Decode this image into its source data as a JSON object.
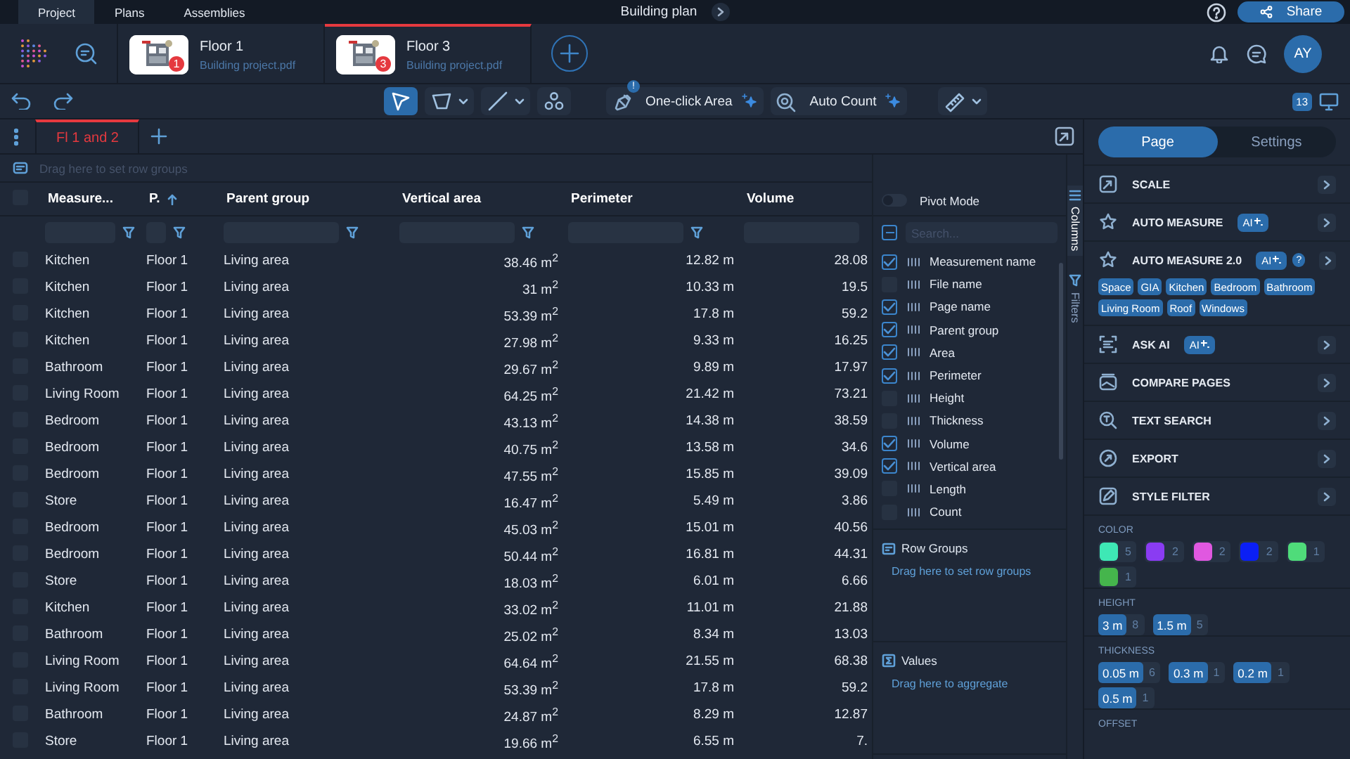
{
  "top_tabs": [
    {
      "label": "Project",
      "selected": true
    },
    {
      "label": "Plans",
      "selected": false
    },
    {
      "label": "Assemblies",
      "selected": false
    }
  ],
  "title": "Building plan",
  "share_button": "Share",
  "documents": [
    {
      "name": "Floor 1",
      "file": "Building project.pdf",
      "badge": "1",
      "selected": false
    },
    {
      "name": "Floor 3",
      "file": "Building project.pdf",
      "badge": "3",
      "selected": true
    }
  ],
  "avatar": "AY",
  "toolbar": {
    "tools": [
      {
        "kind": "select",
        "selected": true,
        "dropdown": false
      },
      {
        "kind": "polygon",
        "selected": false,
        "dropdown": true
      },
      {
        "kind": "line",
        "selected": false,
        "dropdown": true
      },
      {
        "kind": "count",
        "selected": false,
        "dropdown": false
      }
    ],
    "ai_buttons": [
      {
        "kind": "area",
        "label": "One-click Area",
        "badge": "!"
      },
      {
        "kind": "count",
        "label": "Auto Count"
      }
    ],
    "measure_tool": {
      "dropdown": true
    },
    "page_count": "13"
  },
  "sheet_tabs": [
    {
      "label": "Fl 1 and 2",
      "selected": true
    }
  ],
  "grid": {
    "group_hint": "Drag here to set row groups",
    "columns": [
      {
        "label": "Measure...",
        "kind": "text",
        "sorted": false,
        "filter_icon": true
      },
      {
        "label": "P.",
        "kind": "text",
        "sorted": true,
        "filter_icon": true
      },
      {
        "label": "Parent group",
        "kind": "text",
        "sorted": false,
        "filter_icon": true
      },
      {
        "label": "Vertical area",
        "kind": "number",
        "sorted": false,
        "filter_icon": true
      },
      {
        "label": "Perimeter",
        "kind": "number",
        "sorted": false,
        "filter_icon": true
      },
      {
        "label": "Volume",
        "kind": "number",
        "sorted": false,
        "filter_icon": false
      }
    ],
    "all_checked": false,
    "rows": [
      {
        "checked": false,
        "cells": [
          "Kitchen",
          "Floor 1",
          "Living area",
          "38.46 m$^{2}$",
          "12.82 m",
          "28.08"
        ]
      },
      {
        "checked": false,
        "cells": [
          "Kitchen",
          "Floor 1",
          "Living area",
          "31 m$^{2}$",
          "10.33 m",
          "19.5"
        ]
      },
      {
        "checked": false,
        "cells": [
          "Kitchen",
          "Floor 1",
          "Living area",
          "53.39 m$^{2}$",
          "17.8 m",
          "59.2"
        ]
      },
      {
        "checked": false,
        "cells": [
          "Kitchen",
          "Floor 1",
          "Living area",
          "27.98 m$^{2}$",
          "9.33 m",
          "16.25"
        ]
      },
      {
        "checked": false,
        "cells": [
          "Bathroom",
          "Floor 1",
          "Living area",
          "29.67 m$^{2}$",
          "9.89 m",
          "17.97"
        ]
      },
      {
        "checked": false,
        "cells": [
          "Living Room",
          "Floor 1",
          "Living area",
          "64.25 m$^{2}$",
          "21.42 m",
          "73.21"
        ]
      },
      {
        "checked": false,
        "cells": [
          "Bedroom",
          "Floor 1",
          "Living area",
          "43.13 m$^{2}$",
          "14.38 m",
          "38.59"
        ]
      },
      {
        "checked": false,
        "cells": [
          "Bedroom",
          "Floor 1",
          "Living area",
          "40.75 m$^{2}$",
          "13.58 m",
          "34.6"
        ]
      },
      {
        "checked": false,
        "cells": [
          "Bedroom",
          "Floor 1",
          "Living area",
          "47.55 m$^{2}$",
          "15.85 m",
          "39.09"
        ]
      },
      {
        "checked": false,
        "cells": [
          "Store",
          "Floor 1",
          "Living area",
          "16.47 m$^{2}$",
          "5.49 m",
          "3.86"
        ]
      },
      {
        "checked": false,
        "cells": [
          "Bedroom",
          "Floor 1",
          "Living area",
          "45.03 m$^{2}$",
          "15.01 m",
          "40.56"
        ]
      },
      {
        "checked": false,
        "cells": [
          "Bedroom",
          "Floor 1",
          "Living area",
          "50.44 m$^{2}$",
          "16.81 m",
          "44.31"
        ]
      },
      {
        "checked": false,
        "cells": [
          "Store",
          "Floor 1",
          "Living area",
          "18.03 m$^{2}$",
          "6.01 m",
          "6.66"
        ]
      },
      {
        "checked": false,
        "cells": [
          "Kitchen",
          "Floor 1",
          "Living area",
          "33.02 m$^{2}$",
          "11.01 m",
          "21.88"
        ]
      },
      {
        "checked": false,
        "cells": [
          "Bathroom",
          "Floor 1",
          "Living area",
          "25.02 m$^{2}$",
          "8.34 m",
          "13.03"
        ]
      },
      {
        "checked": false,
        "cells": [
          "Living Room",
          "Floor 1",
          "Living area",
          "64.64 m$^{2}$",
          "21.55 m",
          "68.38"
        ]
      },
      {
        "checked": false,
        "cells": [
          "Living Room",
          "Floor 1",
          "Living area",
          "53.39 m$^{2}$",
          "17.8 m",
          "59.2"
        ]
      },
      {
        "checked": false,
        "cells": [
          "Bathroom",
          "Floor 1",
          "Living area",
          "24.87 m$^{2}$",
          "8.29 m",
          "12.87"
        ]
      },
      {
        "checked": false,
        "cells": [
          "Store",
          "Floor 1",
          "Living area",
          "19.66 m$^{2}$",
          "6.55 m",
          "7."
        ]
      }
    ]
  },
  "column_panel": {
    "pivot_mode": false,
    "pivot_label": "Pivot Mode",
    "select_all_indeterminate": true,
    "search_placeholder": "Search...",
    "columns": [
      {
        "label": "Measurement name",
        "checked": true
      },
      {
        "label": "File name",
        "checked": false
      },
      {
        "label": "Page name",
        "checked": true
      },
      {
        "label": "Parent group",
        "checked": true
      },
      {
        "label": "Area",
        "checked": true
      },
      {
        "label": "Perimeter",
        "checked": true
      },
      {
        "label": "Height",
        "checked": false
      },
      {
        "label": "Thickness",
        "checked": false
      },
      {
        "label": "Volume",
        "checked": true
      },
      {
        "label": "Vertical area",
        "checked": true
      },
      {
        "label": "Length",
        "checked": false
      },
      {
        "label": "Count",
        "checked": false
      }
    ],
    "drop_zones": [
      {
        "kind": "groups",
        "title": "Row Groups",
        "hint": "Drag here to set row groups"
      },
      {
        "kind": "values",
        "title": "Values",
        "hint": "Drag here to aggregate"
      }
    ],
    "side_tabs": [
      {
        "kind": "columns",
        "label": "Columns",
        "selected": true
      },
      {
        "kind": "filters",
        "label": "Filters",
        "selected": false
      }
    ]
  },
  "side_panel": {
    "tabs": [
      {
        "label": "Page",
        "selected": true
      },
      {
        "label": "Settings",
        "selected": false
      }
    ],
    "tools": [
      {
        "kind": "scale",
        "label": "SCALE"
      },
      {
        "kind": "auto",
        "label": "AUTO MEASURE",
        "ai_badge": "AI"
      },
      {
        "kind": "auto",
        "label": "AUTO MEASURE 2.0",
        "ai_badge": "AI",
        "help": "?",
        "tags": [
          "Space",
          "GIA",
          "Kitchen",
          "Bedroom",
          "Bathroom",
          "Living Room",
          "Roof",
          "Windows"
        ]
      },
      {
        "kind": "ask",
        "label": "ASK AI",
        "ai_badge": "AI"
      },
      {
        "kind": "compare",
        "label": "COMPARE PAGES"
      },
      {
        "kind": "search",
        "label": "TEXT SEARCH"
      },
      {
        "kind": "export",
        "label": "EXPORT"
      },
      {
        "kind": "style",
        "label": "STYLE FILTER"
      }
    ],
    "filters": [
      {
        "title": "COLOR",
        "kind": "color",
        "options": [
          {
            "color": "#3ee8b5",
            "count": "5"
          },
          {
            "color": "#8a3cf2",
            "count": "2"
          },
          {
            "color": "#e058e0",
            "count": "2"
          },
          {
            "color": "#0b1ff5",
            "count": "2"
          },
          {
            "color": "#4fdc7a",
            "count": "1"
          },
          {
            "color": "#45b54c",
            "count": "1"
          }
        ]
      },
      {
        "title": "HEIGHT",
        "kind": "value",
        "options": [
          {
            "label": "3 m",
            "count": "8"
          },
          {
            "label": "1.5 m",
            "count": "5"
          }
        ]
      },
      {
        "title": "THICKNESS",
        "kind": "value",
        "options": [
          {
            "label": "0.05 m",
            "count": "6"
          },
          {
            "label": "0.3 m",
            "count": "1"
          },
          {
            "label": "0.2 m",
            "count": "1"
          },
          {
            "label": "0.5 m",
            "count": "1"
          }
        ]
      },
      {
        "title": "OFFSET"
      }
    ]
  }
}
